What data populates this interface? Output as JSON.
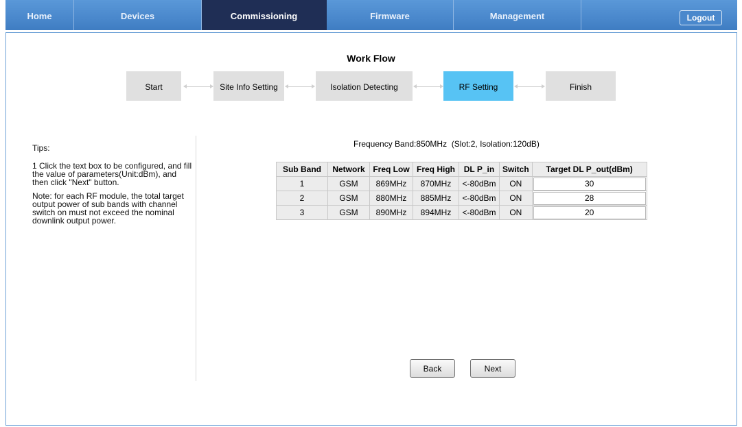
{
  "nav": {
    "items": [
      {
        "label": "Home"
      },
      {
        "label": "Devices"
      },
      {
        "label": "Commissioning"
      },
      {
        "label": "Firmware"
      },
      {
        "label": "Management"
      }
    ],
    "active": "Commissioning",
    "logout_label": "Logout"
  },
  "workflow": {
    "title": "Work Flow",
    "steps": [
      {
        "label": "Start"
      },
      {
        "label": "Site Info Setting"
      },
      {
        "label": "Isolation Detecting"
      },
      {
        "label": "RF Setting"
      },
      {
        "label": "Finish"
      }
    ],
    "current": "RF Setting"
  },
  "tips": {
    "title": "Tips:",
    "line1": "1 Click the text box to be configured, and fill the value of parameters(Unit:dBm), and then click \"Next\" button.",
    "note": "Note: for each RF module, the total target output power of sub bands with channel switch on must not exceed the nominal downlink output power."
  },
  "frequency_info": "Frequency Band:850MHz  (Slot:2, Isolation:120dB)",
  "table": {
    "headers": [
      "Sub Band",
      "Network",
      "Freq Low",
      "Freq High",
      "DL P_in",
      "Switch",
      "Target DL P_out(dBm)"
    ],
    "rows": [
      {
        "sub_band": "1",
        "network": "GSM",
        "freq_low": "869MHz",
        "freq_high": "870MHz",
        "dl_p_in": "<-80dBm",
        "switch": "ON",
        "target": "30"
      },
      {
        "sub_band": "2",
        "network": "GSM",
        "freq_low": "880MHz",
        "freq_high": "885MHz",
        "dl_p_in": "<-80dBm",
        "switch": "ON",
        "target": "28"
      },
      {
        "sub_band": "3",
        "network": "GSM",
        "freq_low": "890MHz",
        "freq_high": "894MHz",
        "dl_p_in": "<-80dBm",
        "switch": "ON",
        "target": "20"
      }
    ]
  },
  "buttons": {
    "back": "Back",
    "next": "Next"
  }
}
